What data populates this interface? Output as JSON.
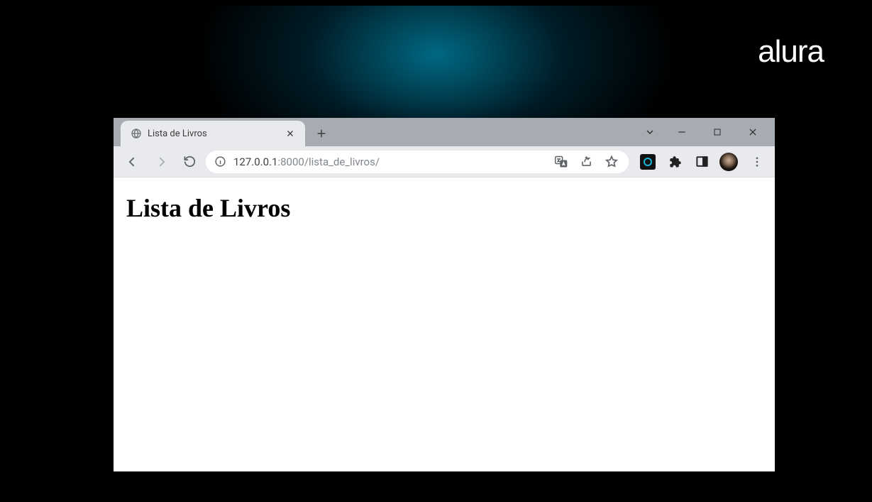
{
  "watermark": "alura",
  "tab": {
    "title": "Lista de Livros"
  },
  "address": {
    "host": "127.0.0.1",
    "port": ":8000",
    "path": "/lista_de_livros/"
  },
  "page": {
    "heading": "Lista de Livros"
  }
}
